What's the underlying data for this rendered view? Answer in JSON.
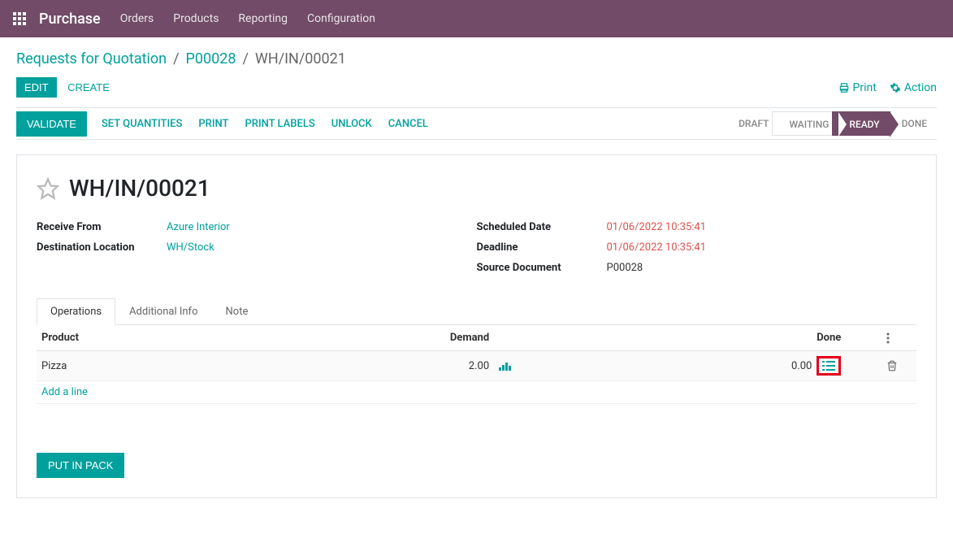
{
  "navbar": {
    "brand": "Purchase",
    "items": [
      "Orders",
      "Products",
      "Reporting",
      "Configuration"
    ]
  },
  "breadcrumb": {
    "root": "Requests for Quotation",
    "parent": "P00028",
    "current": "WH/IN/00021"
  },
  "buttons": {
    "edit": "EDIT",
    "create": "CREATE",
    "print": "Print",
    "action": "Action"
  },
  "status_bar": {
    "validate": "VALIDATE",
    "set_quantities": "SET QUANTITIES",
    "print": "PRINT",
    "print_labels": "PRINT LABELS",
    "unlock": "UNLOCK",
    "cancel": "CANCEL",
    "stages": {
      "draft": "DRAFT",
      "waiting": "WAITING",
      "ready": "READY",
      "done": "DONE"
    }
  },
  "record": {
    "title": "WH/IN/00021",
    "left": {
      "receive_from_label": "Receive From",
      "receive_from_value": "Azure Interior",
      "destination_label": "Destination Location",
      "destination_value": "WH/Stock"
    },
    "right": {
      "scheduled_label": "Scheduled Date",
      "scheduled_value": "01/06/2022 10:35:41",
      "deadline_label": "Deadline",
      "deadline_value": "01/06/2022 10:35:41",
      "source_label": "Source Document",
      "source_value": "P00028"
    }
  },
  "tabs": {
    "operations": "Operations",
    "additional": "Additional Info",
    "note": "Note"
  },
  "table": {
    "headers": {
      "product": "Product",
      "demand": "Demand",
      "done": "Done"
    },
    "rows": [
      {
        "product": "Pizza",
        "demand": "2.00",
        "done": "0.00"
      }
    ],
    "add_line": "Add a line"
  },
  "put_in_pack": "PUT IN PACK"
}
